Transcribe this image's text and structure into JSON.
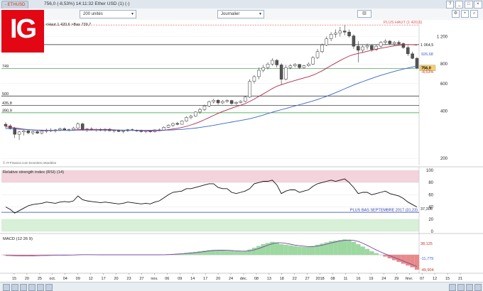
{
  "window": {
    "tab_label": "- ETHUSD",
    "title": "756,0 (-8,53%) 14:11:32 Ether USD (1) (-)",
    "controls": [
      "?",
      "_",
      "□",
      "×"
    ]
  },
  "toolbar": {
    "quantity": "200 unités",
    "period": "Journalier",
    "icons": [
      "gear-icon",
      "crosshair-icon",
      "candlestick-icon",
      "zoom-icon",
      "compare-icon",
      "save-icon"
    ]
  },
  "logo": {
    "text": "IG"
  },
  "colors": {
    "up_candle": "#ffffff",
    "down_candle": "#555555",
    "ma_short": "#b0294a",
    "ma_long": "#3a64c8",
    "resistance_red": "#d9534f",
    "support_green": "#2e9b3a",
    "rsi_line": "#111111",
    "rsi_overbought": "#f3d3dc",
    "rsi_oversold": "#d7f0d7",
    "macd_pos": "#9cd8a0",
    "macd_neg": "#e88a8a",
    "price_label_bg": "#f5d06f"
  },
  "chart_data": [
    {
      "type": "candlestick",
      "panel": "price",
      "annotation_top": "<Haut 1 420,6 >Bas 739,7",
      "plus_haut_label": "PLUS HAUT (1 420,6)",
      "copyright": "© IT-Finance.com Données retardées",
      "y_scale": "log",
      "ylim": [
        190,
        1500
      ],
      "y_ticks": [
        {
          "value": 1200,
          "label": "1 200"
        },
        {
          "value": 800,
          "label": "800"
        },
        {
          "value": 600,
          "label": "600"
        },
        {
          "value": 400,
          "label": "400"
        },
        {
          "value": 200,
          "label": "200"
        }
      ],
      "horizontal_levels": [
        {
          "value": 1420.6,
          "label": "",
          "style": "dash-red"
        },
        {
          "value": 1064.5,
          "label": "1 064,5",
          "style": "line-black",
          "side": "right"
        },
        {
          "value": 749,
          "label": "749",
          "style": "line-green",
          "side": "left"
        },
        {
          "value": 500,
          "label": "500",
          "style": "line-black",
          "side": "left"
        },
        {
          "value": 435.8,
          "label": "435,8",
          "style": "line-black",
          "side": "left"
        },
        {
          "value": 390.9,
          "label": "390,9",
          "style": "line-green",
          "side": "left"
        }
      ],
      "right_labels": [
        {
          "value": 926.68,
          "label": "926,68",
          "color": "#3a64c8"
        },
        {
          "value": 756.0,
          "label": "756,0",
          "color": "#000000",
          "boxed": true
        },
        {
          "value": 715,
          "label": "-8,53%",
          "color": "#c0392b"
        }
      ],
      "x_ticks": [
        "15",
        "20",
        "25",
        "oct.",
        "04",
        "09",
        "12",
        "17",
        "20",
        "23",
        "27",
        "nov.",
        "06",
        "09",
        "14",
        "17",
        "20",
        "24",
        "déc.",
        "08",
        "13",
        "18",
        "22",
        "27",
        "2018",
        "08",
        "11",
        "16",
        "19",
        "24",
        "29",
        "févr.",
        "07",
        "12",
        "15",
        "21"
      ],
      "candles": [
        [
          330,
          340,
          310,
          322
        ],
        [
          322,
          330,
          305,
          312
        ],
        [
          312,
          318,
          270,
          285
        ],
        [
          285,
          300,
          262,
          295
        ],
        [
          295,
          305,
          280,
          300
        ],
        [
          300,
          306,
          285,
          291
        ],
        [
          291,
          300,
          282,
          296
        ],
        [
          296,
          302,
          286,
          290
        ],
        [
          290,
          300,
          284,
          298
        ],
        [
          298,
          310,
          290,
          302
        ],
        [
          302,
          312,
          294,
          300
        ],
        [
          300,
          308,
          292,
          304
        ],
        [
          304,
          314,
          298,
          309
        ],
        [
          309,
          315,
          300,
          303
        ],
        [
          303,
          310,
          296,
          305
        ],
        [
          305,
          318,
          300,
          312
        ],
        [
          312,
          340,
          308,
          332
        ],
        [
          332,
          338,
          300,
          304
        ],
        [
          304,
          312,
          295,
          308
        ],
        [
          308,
          316,
          300,
          303
        ],
        [
          303,
          310,
          296,
          306
        ],
        [
          306,
          312,
          298,
          302
        ],
        [
          302,
          310,
          295,
          307
        ],
        [
          307,
          312,
          298,
          300
        ],
        [
          300,
          306,
          292,
          302
        ],
        [
          302,
          306,
          294,
          297
        ],
        [
          297,
          304,
          290,
          300
        ],
        [
          300,
          308,
          296,
          305
        ],
        [
          305,
          310,
          298,
          302
        ],
        [
          302,
          306,
          295,
          299
        ],
        [
          299,
          305,
          292,
          297
        ],
        [
          297,
          302,
          290,
          300
        ],
        [
          300,
          304,
          292,
          296
        ],
        [
          296,
          306,
          292,
          304
        ],
        [
          304,
          310,
          298,
          302
        ],
        [
          302,
          320,
          300,
          316
        ],
        [
          316,
          330,
          312,
          325
        ],
        [
          325,
          338,
          318,
          334
        ],
        [
          334,
          342,
          326,
          330
        ],
        [
          330,
          350,
          328,
          346
        ],
        [
          346,
          372,
          342,
          365
        ],
        [
          365,
          380,
          355,
          372
        ],
        [
          372,
          400,
          368,
          395
        ],
        [
          395,
          420,
          385,
          410
        ],
        [
          410,
          440,
          402,
          432
        ],
        [
          432,
          468,
          425,
          460
        ],
        [
          460,
          480,
          448,
          470
        ],
        [
          470,
          478,
          440,
          452
        ],
        [
          452,
          470,
          445,
          462
        ],
        [
          462,
          475,
          452,
          468
        ],
        [
          468,
          472,
          440,
          448
        ],
        [
          448,
          462,
          440,
          455
        ],
        [
          455,
          470,
          448,
          462
        ],
        [
          462,
          500,
          455,
          492
        ],
        [
          492,
          640,
          486,
          620
        ],
        [
          620,
          680,
          600,
          665
        ],
        [
          665,
          760,
          640,
          730
        ],
        [
          730,
          790,
          710,
          760
        ],
        [
          760,
          820,
          740,
          800
        ],
        [
          800,
          870,
          780,
          845
        ],
        [
          845,
          860,
          760,
          790
        ],
        [
          790,
          810,
          590,
          640
        ],
        [
          640,
          790,
          630,
          760
        ],
        [
          760,
          800,
          740,
          780
        ],
        [
          780,
          810,
          760,
          795
        ],
        [
          795,
          800,
          745,
          760
        ],
        [
          760,
          790,
          750,
          780
        ],
        [
          780,
          820,
          770,
          800
        ],
        [
          800,
          900,
          790,
          880
        ],
        [
          880,
          1000,
          860,
          960
        ],
        [
          960,
          1080,
          940,
          1060
        ],
        [
          1060,
          1200,
          1040,
          1160
        ],
        [
          1160,
          1280,
          1120,
          1240
        ],
        [
          1240,
          1330,
          1180,
          1260
        ],
        [
          1260,
          1380,
          1200,
          1300
        ],
        [
          1300,
          1420,
          1220,
          1280
        ],
        [
          1280,
          1330,
          1180,
          1210
        ],
        [
          1210,
          1240,
          1000,
          1040
        ],
        [
          1040,
          1120,
          820,
          980
        ],
        [
          980,
          1060,
          940,
          1030
        ],
        [
          1030,
          1080,
          990,
          1050
        ],
        [
          1050,
          1070,
          960,
          990
        ],
        [
          990,
          1060,
          970,
          1040
        ],
        [
          1040,
          1120,
          1020,
          1100
        ],
        [
          1100,
          1150,
          1060,
          1120
        ],
        [
          1120,
          1140,
          1060,
          1080
        ],
        [
          1080,
          1120,
          1050,
          1100
        ],
        [
          1100,
          1130,
          1060,
          1080
        ],
        [
          1080,
          1100,
          1000,
          1020
        ],
        [
          1020,
          1050,
          900,
          930
        ],
        [
          930,
          960,
          860,
          870
        ],
        [
          870,
          890,
          740,
          756
        ]
      ],
      "series": [
        {
          "name": "",
          "values": [
            318,
            316,
            313,
            310,
            307,
            305,
            303,
            302,
            301,
            301,
            301,
            301,
            302,
            302,
            302,
            303,
            305,
            306,
            306,
            306,
            306,
            305,
            305,
            305,
            304,
            303,
            302,
            302,
            302,
            301,
            300,
            300,
            299,
            300,
            300,
            302,
            305,
            308,
            311,
            315,
            320,
            327,
            334,
            343,
            353,
            364,
            376,
            387,
            398,
            408,
            418,
            428,
            437,
            447,
            462,
            478,
            497,
            516,
            536,
            558,
            578,
            590,
            604,
            616,
            628,
            640,
            652,
            664,
            680,
            700,
            724,
            752,
            782,
            812,
            842,
            872,
            900,
            920,
            935,
            950,
            965,
            980,
            995,
            1010,
            1022,
            1034,
            1045,
            1054,
            1062,
            1066,
            1064,
            1056
          ]
        },
        {
          "name": "",
          "values": [
            310,
            309,
            308,
            307,
            306,
            305,
            304,
            303,
            303,
            302,
            302,
            302,
            302,
            302,
            302,
            302,
            303,
            303,
            303,
            303,
            303,
            303,
            303,
            303,
            303,
            303,
            303,
            302,
            302,
            302,
            302,
            302,
            302,
            302,
            302,
            303,
            303,
            304,
            305,
            306,
            308,
            310,
            312,
            315,
            318,
            321,
            325,
            329,
            333,
            337,
            341,
            345,
            349,
            353,
            358,
            364,
            371,
            378,
            386,
            394,
            402,
            409,
            416,
            424,
            432,
            440,
            448,
            456,
            465,
            475,
            486,
            498,
            511,
            525,
            540,
            556,
            572,
            588,
            603,
            618,
            633,
            648,
            663,
            677,
            691,
            705,
            718,
            731,
            743,
            755,
            765,
            776
          ]
        }
      ]
    },
    {
      "type": "line",
      "panel": "rsi",
      "title": "Relative strength index (RSI) (14)",
      "ylim": [
        0,
        100
      ],
      "y_ticks": [
        100,
        80,
        60,
        40,
        20,
        0
      ],
      "levels": [
        {
          "value": 31.23,
          "label": "PLUS BAS SEPTEMBRE 2017 (31,23)"
        }
      ],
      "last_value_label": "37,306",
      "values": [
        40,
        36,
        30,
        34,
        38,
        42,
        44,
        45,
        46,
        48,
        47,
        46,
        48,
        49,
        48,
        50,
        58,
        52,
        50,
        49,
        48,
        47,
        48,
        47,
        46,
        45,
        46,
        48,
        47,
        46,
        45,
        46,
        45,
        48,
        50,
        55,
        60,
        64,
        65,
        66,
        70,
        70,
        72,
        74,
        76,
        78,
        78,
        72,
        70,
        70,
        64,
        62,
        64,
        66,
        70,
        78,
        80,
        82,
        82,
        84,
        76,
        62,
        66,
        68,
        68,
        64,
        66,
        68,
        74,
        78,
        80,
        82,
        84,
        82,
        84,
        86,
        80,
        72,
        62,
        64,
        64,
        60,
        62,
        64,
        66,
        62,
        60,
        58,
        54,
        48,
        44,
        40
      ]
    },
    {
      "type": "histogram",
      "panel": "macd",
      "title": "MACD (12 26 9)",
      "ylim": [
        -55,
        60
      ],
      "right_labels": [
        {
          "value": 38.125,
          "label": "38,125",
          "color": "#c0392b"
        },
        {
          "value": -11.779,
          "label": "-11,779",
          "color": "#3a64c8"
        },
        {
          "value": -49.904,
          "label": "-49,904",
          "color": "#c0392b"
        }
      ],
      "values": [
        -2,
        -3,
        -4,
        -4,
        -4,
        -3,
        -3,
        -2,
        -2,
        -2,
        -1,
        -1,
        -1,
        -1,
        0,
        0,
        1,
        1,
        0,
        0,
        0,
        0,
        0,
        0,
        0,
        0,
        0,
        0,
        0,
        0,
        0,
        0,
        0,
        0,
        0,
        1,
        2,
        3,
        4,
        5,
        7,
        8,
        10,
        12,
        14,
        16,
        17,
        16,
        15,
        14,
        13,
        12,
        12,
        13,
        18,
        24,
        30,
        36,
        40,
        44,
        42,
        36,
        34,
        32,
        30,
        28,
        27,
        27,
        30,
        34,
        38,
        42,
        46,
        48,
        50,
        52,
        50,
        44,
        36,
        28,
        20,
        12,
        6,
        0,
        -6,
        -12,
        -18,
        -24,
        -30,
        -36,
        -42,
        -50
      ]
    }
  ]
}
